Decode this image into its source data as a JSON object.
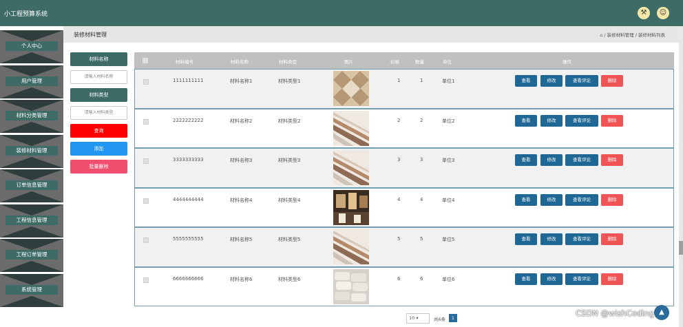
{
  "app": {
    "title": "小工程预算系统"
  },
  "topbar": {
    "icon_tools": "⚒",
    "icon_user": "☺"
  },
  "sidebar": {
    "items": [
      {
        "label": "个人中心"
      },
      {
        "label": "用户管理"
      },
      {
        "label": "材料分类管理"
      },
      {
        "label": "装修材料管理"
      },
      {
        "label": "订单信息管理"
      },
      {
        "label": "工程信息管理"
      },
      {
        "label": "工程订单管理"
      },
      {
        "label": "系统管理"
      }
    ]
  },
  "header": {
    "title": "装修材料管理",
    "breadcrumb": "⌂ / 装修材料管理 / 装修材料列表"
  },
  "filter": {
    "name_label": "材料名称",
    "name_placeholder": "请输入材料名称",
    "type_label": "材料类型",
    "type_placeholder": "请输入材料类型",
    "search_btn": "查询",
    "add_btn": "添加",
    "batch_delete_btn": "批量删除"
  },
  "table": {
    "columns": [
      "材料编号",
      "材料名称",
      "材料类型",
      "图片",
      "价格",
      "数量",
      "单位",
      "操作"
    ],
    "rows": [
      {
        "code": "1111111111",
        "name": "材料名称1",
        "type": "材料类型1",
        "price": "1",
        "qty": "1",
        "unit": "单位1",
        "img": "tile"
      },
      {
        "code": "2222222222",
        "name": "材料名称2",
        "type": "材料类型2",
        "price": "2",
        "qty": "2",
        "unit": "单位2",
        "img": "planks"
      },
      {
        "code": "3333333333",
        "name": "材料名称3",
        "type": "材料类型3",
        "price": "3",
        "qty": "3",
        "unit": "单位3",
        "img": "planks"
      },
      {
        "code": "4444444444",
        "name": "材料名称4",
        "type": "材料类型4",
        "price": "4",
        "qty": "4",
        "unit": "单位4",
        "img": "room"
      },
      {
        "code": "5555555555",
        "name": "材料名称5",
        "type": "材料类型5",
        "price": "5",
        "qty": "5",
        "unit": "单位5",
        "img": "planks"
      },
      {
        "code": "6666666666",
        "name": "材料名称6",
        "type": "材料类型6",
        "price": "6",
        "qty": "6",
        "unit": "单位6",
        "img": "bags"
      }
    ],
    "actions": {
      "view": "查看",
      "edit": "修改",
      "review": "查看评论",
      "delete": "删除"
    }
  },
  "pagination": {
    "page_size": "10",
    "total": "共6条",
    "current": "1"
  },
  "watermark": "CSDN @wishCoding",
  "colors": {
    "topbar": "#3f6b67",
    "primary": "#1f6794",
    "danger": "#f05454",
    "search": "#ff0000",
    "add": "#2196f3",
    "batch": "#f0506e"
  }
}
